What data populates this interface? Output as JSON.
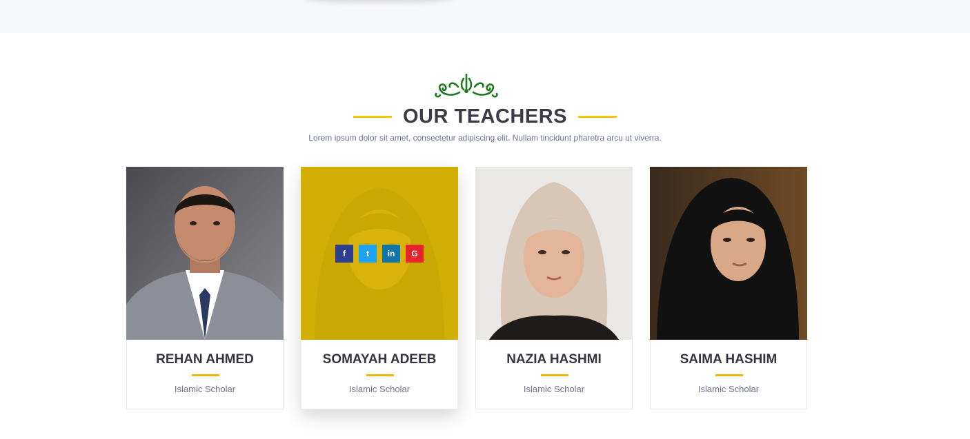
{
  "section": {
    "title": "OUR TEACHERS",
    "subtitle": "Lorem ipsum dolor sit amet, consectetur adipiscing elit. Nullam tincidunt pharetra arcu ut viverra."
  },
  "colors": {
    "accent": "#f5c400",
    "heading": "#3b3b46",
    "overlay": "#dbb700",
    "ornament": "#1f7a1f"
  },
  "teachers": [
    {
      "name": "REHAN AHMED",
      "role": "Islamic Scholar"
    },
    {
      "name": "SOMAYAH ADEEB",
      "role": "Islamic Scholar",
      "active": true
    },
    {
      "name": "NAZIA HASHMI",
      "role": "Islamic Scholar"
    },
    {
      "name": "SAIMA HASHIM",
      "role": "Islamic Scholar"
    }
  ],
  "social": {
    "facebook": "f",
    "twitter": "t",
    "linkedin": "in",
    "google": "G"
  }
}
